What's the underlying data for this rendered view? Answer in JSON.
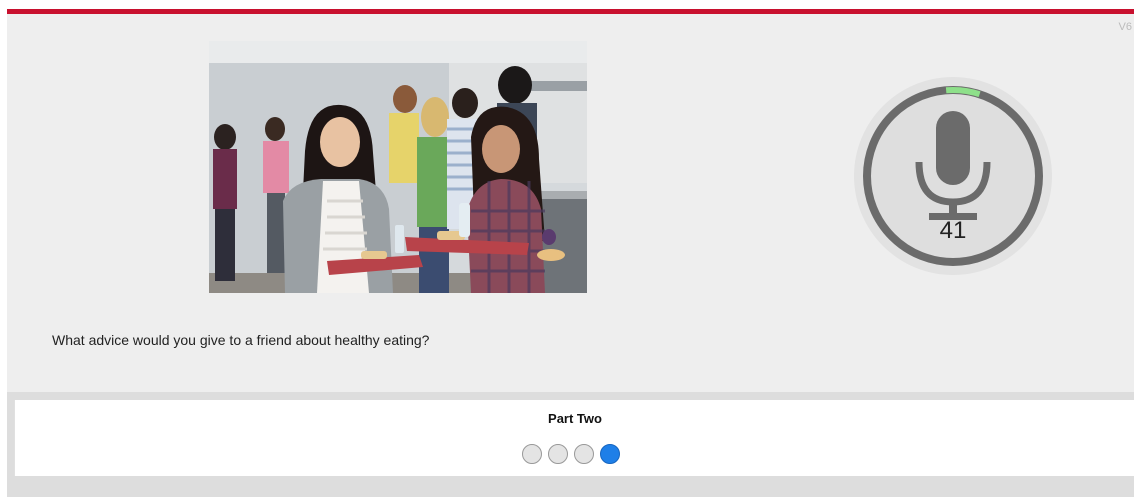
{
  "header": {
    "version_label": "V6",
    "accent_color": "#c8102e"
  },
  "question": {
    "image_icon": "cafeteria-photo",
    "text": "What advice would you give to a friend about healthy eating?"
  },
  "recorder": {
    "icon": "microphone-icon",
    "countdown": "41",
    "progress_fraction": 0.05,
    "progress_color": "#8ee08a",
    "ring_color": "#6b6b6b"
  },
  "footer": {
    "part_title": "Part Two",
    "steps": [
      {
        "state": "incomplete"
      },
      {
        "state": "incomplete"
      },
      {
        "state": "incomplete"
      },
      {
        "state": "current"
      }
    ],
    "current_color": "#1e7fe8"
  }
}
